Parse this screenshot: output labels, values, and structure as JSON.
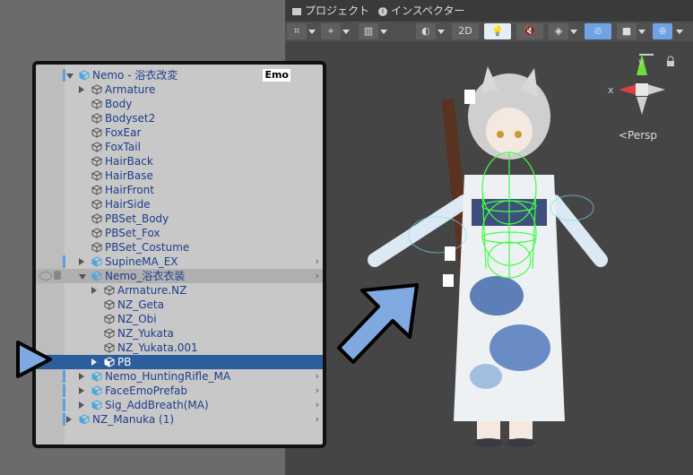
{
  "hierarchy": {
    "rows": [
      {
        "label": "Nemo - 浴衣改変",
        "indent": 0,
        "expand": "down",
        "prefab": true
      },
      {
        "label": "Armature",
        "indent": 1,
        "expand": "right",
        "prefab": false
      },
      {
        "label": "Body",
        "indent": 1,
        "expand": "none",
        "prefab": false
      },
      {
        "label": "Bodyset2",
        "indent": 1,
        "expand": "none",
        "prefab": false
      },
      {
        "label": "FoxEar",
        "indent": 1,
        "expand": "none",
        "prefab": false
      },
      {
        "label": "FoxTail",
        "indent": 1,
        "expand": "none",
        "prefab": false
      },
      {
        "label": "HairBack",
        "indent": 1,
        "expand": "none",
        "prefab": false
      },
      {
        "label": "HairBase",
        "indent": 1,
        "expand": "none",
        "prefab": false
      },
      {
        "label": "HairFront",
        "indent": 1,
        "expand": "none",
        "prefab": false
      },
      {
        "label": "HairSide",
        "indent": 1,
        "expand": "none",
        "prefab": false
      },
      {
        "label": "PBSet_Body",
        "indent": 1,
        "expand": "none",
        "prefab": false
      },
      {
        "label": "PBSet_Fox",
        "indent": 1,
        "expand": "none",
        "prefab": false
      },
      {
        "label": "PBSet_Costume",
        "indent": 1,
        "expand": "none",
        "prefab": false
      },
      {
        "label": "SupineMA_EX",
        "indent": 1,
        "expand": "right",
        "prefab": true
      },
      {
        "label": "Nemo_浴衣衣装",
        "indent": 1,
        "expand": "down",
        "prefab": true
      },
      {
        "label": "Armature.NZ",
        "indent": 2,
        "expand": "right",
        "prefab": false
      },
      {
        "label": "NZ_Geta",
        "indent": 2,
        "expand": "none",
        "prefab": false
      },
      {
        "label": "NZ_Obi",
        "indent": 2,
        "expand": "none",
        "prefab": false
      },
      {
        "label": "NZ_Yukata",
        "indent": 2,
        "expand": "none",
        "prefab": false
      },
      {
        "label": "NZ_Yukata.001",
        "indent": 2,
        "expand": "none",
        "prefab": false
      },
      {
        "label": "PB",
        "indent": 2,
        "expand": "right",
        "prefab": true
      },
      {
        "label": "Nemo_HuntingRifle_MA",
        "indent": 1,
        "expand": "right",
        "prefab": true
      },
      {
        "label": "FaceEmoPrefab",
        "indent": 1,
        "expand": "right",
        "prefab": true
      },
      {
        "label": "Sig_AddBreath(MA)",
        "indent": 1,
        "expand": "right",
        "prefab": true
      },
      {
        "label": "NZ_Manuka (1)",
        "indent": 0,
        "expand": "right",
        "prefab": true
      }
    ],
    "badge": "Emo",
    "selected_index": 20
  },
  "scene": {
    "tabs": [
      {
        "label": "プロジェクト",
        "icon": "folder-icon"
      },
      {
        "label": "インスペクター",
        "icon": "info-icon"
      }
    ],
    "toolbar_2d": "2D",
    "persp_label": "<Persp",
    "gizmo_x_label": "x",
    "gizmo_y_label": "y"
  },
  "colors": {
    "selection": "#2c5d9c",
    "arrow_fill": "#7fa9e0",
    "prefab_icon": "#4aa7e0"
  }
}
